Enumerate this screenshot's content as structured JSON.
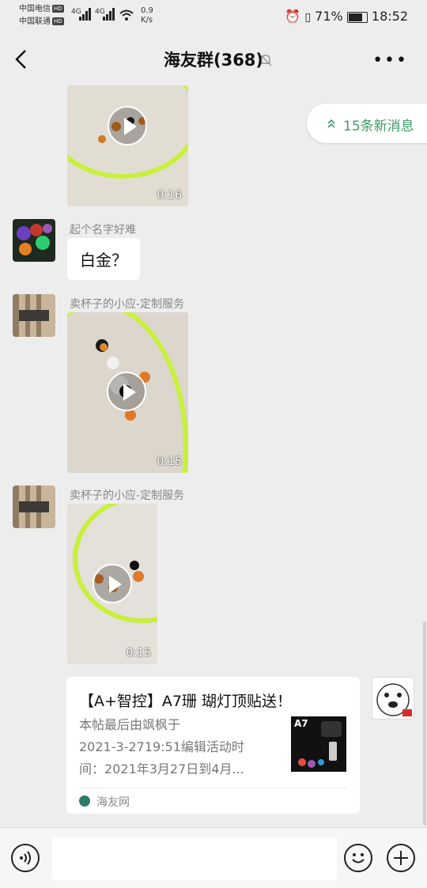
{
  "status": {
    "carrier1": "中国电信",
    "carrier2": "中国联通",
    "hd": "HD",
    "net1": "4G",
    "net2": "4G",
    "speed_value": "0.9",
    "speed_unit": "K/s",
    "battery": "71%",
    "time": "18:52"
  },
  "header": {
    "title": "海友群(368)"
  },
  "new_messages": {
    "label": "15条新消息"
  },
  "messages": [
    {
      "type": "video",
      "duration": "0:16"
    },
    {
      "type": "text",
      "sender": "起个名字好难",
      "text": "白金？"
    },
    {
      "type": "video",
      "sender": "卖杯子的小应-定制服务",
      "duration": "0:15"
    },
    {
      "type": "video",
      "sender": "卖杯子的小应-定制服务",
      "duration": "0:15"
    },
    {
      "type": "link_card",
      "title": "【A+智控】A7珊 瑚灯顶贴送！",
      "desc_line1": "本帖最后由飒枫于",
      "desc_line2": "2021-3-2719:51编辑活动时",
      "desc_line3": "间：2021年3月27日到4月...",
      "thumb_label": "A7",
      "source": "海友网"
    }
  ],
  "input": {
    "placeholder": ""
  },
  "colors": {
    "accent_green": "#3f9a63",
    "net_yellow": "#c8f03c",
    "background": "#ededed"
  }
}
